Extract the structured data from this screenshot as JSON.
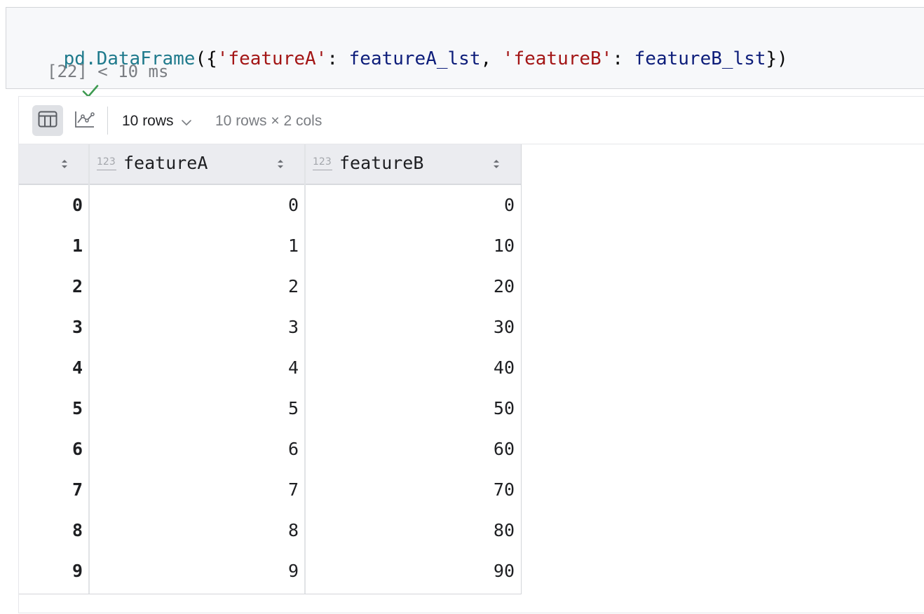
{
  "cell": {
    "code": {
      "tokens": [
        {
          "text": "pd.DataFrame",
          "kind": "ident"
        },
        {
          "text": "({",
          "kind": "punc"
        },
        {
          "text": "'featureA'",
          "kind": "str"
        },
        {
          "text": ": ",
          "kind": "punc"
        },
        {
          "text": "featureA_lst",
          "kind": "var"
        },
        {
          "text": ", ",
          "kind": "punc"
        },
        {
          "text": "'featureB'",
          "kind": "str"
        },
        {
          "text": ": ",
          "kind": "punc"
        },
        {
          "text": "featureB_lst",
          "kind": "var"
        },
        {
          "text": "})",
          "kind": "punc"
        }
      ]
    },
    "status": {
      "icon": "check-icon",
      "execution_count": "[22]",
      "duration": "< 10 ms",
      "color": "#3d9a50"
    }
  },
  "output": {
    "toolbar": {
      "table_view_icon": "table-icon",
      "chart_view_icon": "line-chart-icon",
      "rows_label": "10 rows",
      "shape_label": "10 rows × 2 cols"
    },
    "table": {
      "columns": [
        {
          "name": "featureA",
          "type_badge": "123"
        },
        {
          "name": "featureB",
          "type_badge": "123"
        }
      ],
      "rows": [
        {
          "index": "0",
          "featureA": "0",
          "featureB": "0"
        },
        {
          "index": "1",
          "featureA": "1",
          "featureB": "10"
        },
        {
          "index": "2",
          "featureA": "2",
          "featureB": "20"
        },
        {
          "index": "3",
          "featureA": "3",
          "featureB": "30"
        },
        {
          "index": "4",
          "featureA": "4",
          "featureB": "40"
        },
        {
          "index": "5",
          "featureA": "5",
          "featureB": "50"
        },
        {
          "index": "6",
          "featureA": "6",
          "featureB": "60"
        },
        {
          "index": "7",
          "featureA": "7",
          "featureB": "70"
        },
        {
          "index": "8",
          "featureA": "8",
          "featureB": "80"
        },
        {
          "index": "9",
          "featureA": "9",
          "featureB": "90"
        }
      ]
    }
  }
}
